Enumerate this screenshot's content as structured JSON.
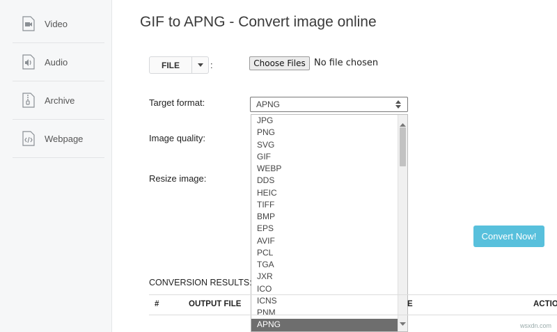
{
  "sidebar": {
    "items": [
      {
        "label": "Video",
        "icon": "video-file-icon"
      },
      {
        "label": "Audio",
        "icon": "audio-file-icon"
      },
      {
        "label": "Archive",
        "icon": "archive-file-icon"
      },
      {
        "label": "Webpage",
        "icon": "webpage-file-icon"
      }
    ]
  },
  "page": {
    "title": "GIF to APNG - Convert image online"
  },
  "upload": {
    "file_label": "FILE",
    "colon": ":",
    "choose_label": "Choose Files",
    "no_file_text": "No file chosen"
  },
  "form": {
    "target_format_label": "Target format:",
    "image_quality_label": "Image quality:",
    "resize_image_label": "Resize image:",
    "selected_format": "APNG",
    "format_options": [
      "JPG",
      "PNG",
      "SVG",
      "GIF",
      "WEBP",
      "DDS",
      "HEIC",
      "TIFF",
      "BMP",
      "EPS",
      "AVIF",
      "PCL",
      "TGA",
      "JXR",
      "ICO",
      "ICNS",
      "PNM",
      "APNG"
    ]
  },
  "actions": {
    "convert_label": "Convert Now!"
  },
  "results": {
    "title": "CONVERSION RESULTS:",
    "columns": [
      "#",
      "OUTPUT FILE",
      "E",
      "ACTIO"
    ]
  },
  "watermark": "wsxdn.com",
  "colors": {
    "accent": "#58c0dc",
    "selected_option_bg": "#6e6e6e",
    "sidebar_bg": "#f6f7f8"
  }
}
